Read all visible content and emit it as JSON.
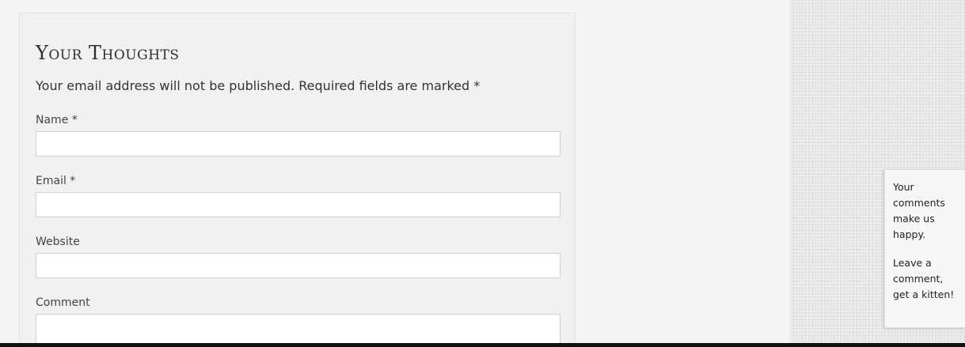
{
  "comment_form": {
    "title": "Your Thoughts",
    "notes": "Your email address will not be published. Required fields are marked *",
    "name_label": "Name *",
    "name_value": "",
    "email_label": "Email *",
    "email_value": "",
    "website_label": "Website",
    "website_value": "",
    "comment_label": "Comment",
    "comment_value": ""
  },
  "side_tab": {
    "line1": "Your comments make us happy.",
    "line2": "Leave a comment, get a kitten!"
  },
  "colors": {
    "page_background": "#f4f4f4",
    "form_background": "#f1f1f1",
    "sidebar_background": "#e6e6e6",
    "bottom_bar": "#111111"
  }
}
